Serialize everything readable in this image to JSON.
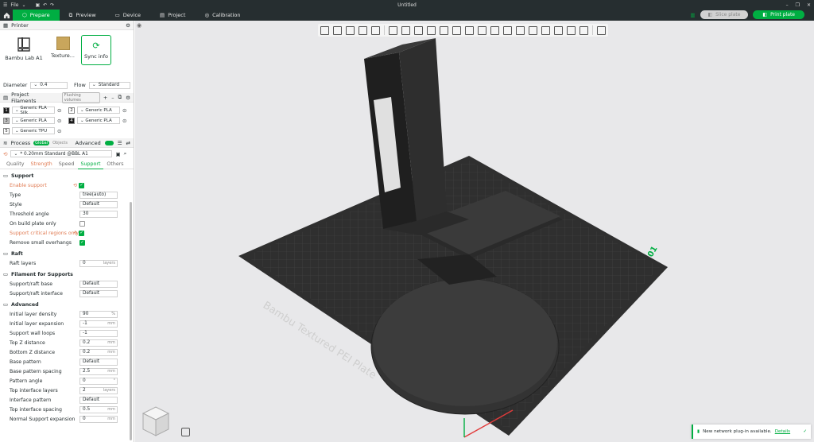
{
  "titlebar": {
    "file_menu": "File",
    "title": "Untitled"
  },
  "menubar": {
    "tabs": [
      {
        "label": "Prepare"
      },
      {
        "label": "Preview"
      },
      {
        "label": "Device"
      },
      {
        "label": "Project"
      },
      {
        "label": "Calibration"
      }
    ],
    "slice_label": "Slice plate",
    "print_label": "Print plate"
  },
  "printer": {
    "header": "Printer",
    "model": "Bambu Lab A1",
    "plate": "Texture...",
    "sync": "Sync info",
    "diameter_label": "Diameter",
    "diameter_value": "0.4",
    "flow_label": "Flow",
    "flow_value": "Standard"
  },
  "filaments": {
    "header": "Project Filaments",
    "flushing": "Flushing volumes",
    "items": [
      {
        "num": "1",
        "name": "Generic PLA Silk",
        "color": "#1a1a1a"
      },
      {
        "num": "2",
        "name": "Generic PLA",
        "color": "#ffffff"
      },
      {
        "num": "3",
        "name": "Generic PLA",
        "color": "#bfbfbf"
      },
      {
        "num": "4",
        "name": "Generic PLA",
        "color": "#1a1a1a"
      },
      {
        "num": "5",
        "name": "Generic TPU",
        "color": "#ffffff"
      }
    ]
  },
  "process": {
    "header": "Process",
    "global": "Global",
    "objects": "Objects",
    "advanced": "Advanced",
    "preset": "* 0.20mm Standard @BBL A1",
    "tabs": [
      "Quality",
      "Strength",
      "Speed",
      "Support",
      "Others"
    ]
  },
  "support": {
    "group": "Support",
    "rows": [
      {
        "label": "Enable support",
        "type": "check",
        "on": true,
        "mod": true
      },
      {
        "label": "Type",
        "value": "tree(auto)"
      },
      {
        "label": "Style",
        "value": "Default"
      },
      {
        "label": "Threshold angle",
        "value": "30"
      },
      {
        "label": "On build plate only",
        "type": "check",
        "on": false
      },
      {
        "label": "Support critical regions only",
        "type": "check",
        "on": true,
        "mod": true
      },
      {
        "label": "Remove small overhangs",
        "type": "check",
        "on": true
      }
    ]
  },
  "raft": {
    "group": "Raft",
    "rows": [
      {
        "label": "Raft layers",
        "value": "0",
        "unit": "layers"
      }
    ]
  },
  "filsupport": {
    "group": "Filament for Supports",
    "rows": [
      {
        "label": "Support/raft base",
        "value": "Default"
      },
      {
        "label": "Support/raft interface",
        "value": "Default"
      }
    ]
  },
  "advanced": {
    "group": "Advanced",
    "rows": [
      {
        "label": "Initial layer density",
        "value": "90",
        "unit": "%"
      },
      {
        "label": "Initial layer expansion",
        "value": "-1",
        "unit": "mm"
      },
      {
        "label": "Support wall loops",
        "value": "-1"
      },
      {
        "label": "Top Z distance",
        "value": "0.2",
        "unit": "mm"
      },
      {
        "label": "Bottom Z distance",
        "value": "0.2",
        "unit": "mm"
      },
      {
        "label": "Base pattern",
        "value": "Default"
      },
      {
        "label": "Base pattern spacing",
        "value": "2.5",
        "unit": "mm"
      },
      {
        "label": "Pattern angle",
        "value": "0",
        "unit": "°"
      },
      {
        "label": "Top interface layers",
        "value": "2",
        "unit": "layers"
      },
      {
        "label": "Interface pattern",
        "value": "Default"
      },
      {
        "label": "Top interface spacing",
        "value": "0.5",
        "unit": "mm"
      },
      {
        "label": "Normal Support expansion",
        "value": "0",
        "unit": "mm"
      }
    ]
  },
  "plate": {
    "text": "Bambu Textured PEI Plate",
    "num": "01"
  },
  "notice": {
    "text": "New network plug-in available.",
    "link": "Details"
  },
  "colors": {
    "accent": "#00ae42",
    "dark": "#262e30",
    "modified": "#e07b53"
  }
}
